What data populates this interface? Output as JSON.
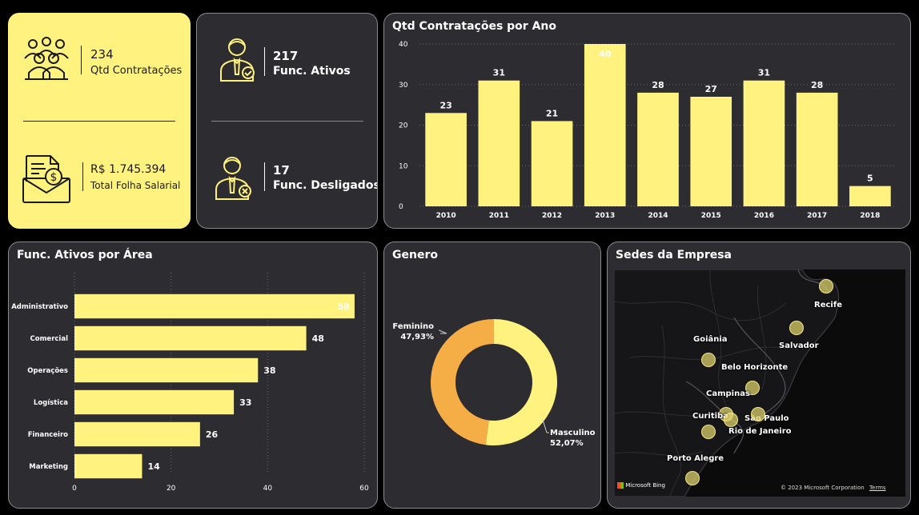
{
  "kpis": {
    "contratacoes": {
      "value": "234",
      "label": "Qtd Contratações"
    },
    "folha": {
      "value": "R$ 1.745.394",
      "label": "Total Folha Salarial"
    },
    "ativos": {
      "value": "217",
      "label": "Func. Ativos"
    },
    "desligados": {
      "value": "17",
      "label": "Func. Desligados"
    }
  },
  "icons": {
    "contratacoes": "group-people-icon",
    "folha": "payroll-envelope-icon",
    "ativos": "employee-check-icon",
    "desligados": "employee-cross-icon"
  },
  "colors": {
    "accent": "#fff27e",
    "accent_dark": "#f5ad45",
    "card_bg": "#2c2c31",
    "page_bg": "#000000"
  },
  "chart_data": [
    {
      "type": "bar",
      "title": "Qtd Contratações por Ano",
      "categories": [
        "2010",
        "2011",
        "2012",
        "2013",
        "2014",
        "2015",
        "2016",
        "2017",
        "2018"
      ],
      "values": [
        23,
        31,
        21,
        40,
        28,
        27,
        31,
        28,
        5
      ],
      "ylim": [
        0,
        40
      ],
      "yticks": [
        0,
        10,
        20,
        30,
        40
      ],
      "grid": true
    },
    {
      "type": "bar",
      "orientation": "horizontal",
      "title": "Func. Ativos por Área",
      "categories": [
        "Administrativo",
        "Comercial",
        "Operações",
        "Logística",
        "Financeiro",
        "Marketing"
      ],
      "values": [
        58,
        48,
        38,
        33,
        26,
        14
      ],
      "xlim": [
        0,
        60
      ],
      "xticks": [
        0,
        20,
        40,
        60
      ],
      "grid": true
    },
    {
      "type": "pie",
      "title": "Genero",
      "categories": [
        "Feminino",
        "Masculino"
      ],
      "values": [
        47.93,
        52.07
      ],
      "labels": [
        "47,93%",
        "52,07%"
      ],
      "colors": [
        "#f5ad45",
        "#fff27e"
      ]
    }
  ],
  "map": {
    "title": "Sedes da Empresa",
    "cities": [
      "Recife",
      "Salvador",
      "Goiânia",
      "Belo Horizonte",
      "Campinas",
      "Curitiba",
      "São Paulo",
      "Rio de Janeiro",
      "Porto Alegre"
    ],
    "attribution": "© 2023 Microsoft Corporation",
    "terms": "Terms",
    "brand": "Microsoft Bing"
  }
}
